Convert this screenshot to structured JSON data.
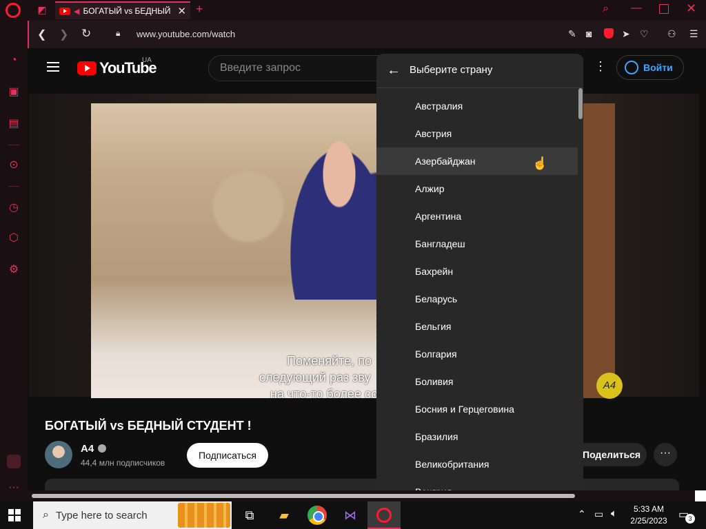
{
  "browser": {
    "tab_title": "БОГАТЫЙ vs БЕДНЫЙ",
    "url": "www.youtube.com/watch"
  },
  "youtube": {
    "logo_text": "YouTube",
    "country_code": "UA",
    "search_placeholder": "Введите запрос",
    "signin_label": "Войти",
    "subtitles": [
      "Поменяйте, по",
      "следующий раз зву",
      "на что-то более со"
    ],
    "badge_text": "А4",
    "video_title": "БОГАТЫЙ vs БЕДНЫЙ СТУДЕНТ !",
    "channel_name": "А4",
    "channel_subs": "44,4 млн подписчиков",
    "subscribe_label": "Подписаться",
    "share_label": "Поделиться",
    "more_label": "···"
  },
  "country_menu": {
    "title": "Выберите страну",
    "hovered_index": 2,
    "countries": [
      "Австралия",
      "Австрия",
      "Азербайджан",
      "Алжир",
      "Аргентина",
      "Бангладеш",
      "Бахрейн",
      "Беларусь",
      "Бельгия",
      "Болгария",
      "Боливия",
      "Босния и Герцеговина",
      "Бразилия",
      "Великобритания",
      "Венгрия"
    ]
  },
  "taskbar": {
    "search_placeholder": "Type here to search",
    "time": "5:33 AM",
    "date": "2/25/2023",
    "notification_count": "3"
  },
  "colors": {
    "opera_accent": "#e1325e",
    "youtube_red": "#ff0000",
    "signin_blue": "#3ea6ff"
  }
}
